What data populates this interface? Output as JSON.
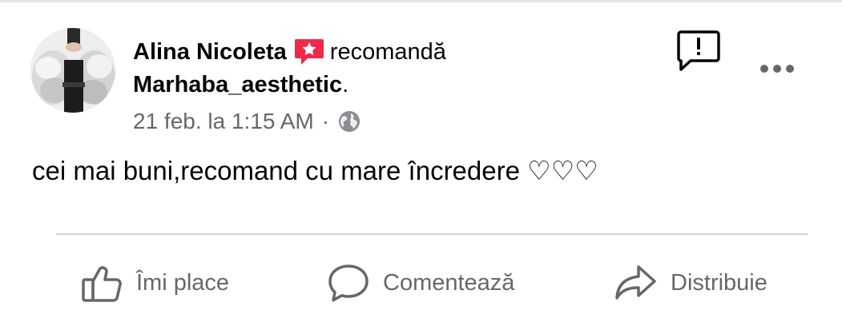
{
  "post": {
    "author_name": "Alina Nicoleta",
    "recommend_verb": "recomandă",
    "page_name": "Marhaba_aesthetic",
    "page_suffix": ".",
    "timestamp": "21 feb. la 1:15 AM",
    "separator": "·",
    "audience_icon": "globe-icon",
    "body_text": "cei mai buni,recomand cu mare încredere ♡♡♡"
  },
  "header_actions": {
    "report_icon": "report-icon",
    "more_icon": "more-options-icon"
  },
  "actions": {
    "like_label": "Îmi place",
    "comment_label": "Comentează",
    "share_label": "Distribuie"
  },
  "colors": {
    "primary_text": "#050505",
    "secondary_text": "#65676b",
    "recommend_badge": "#f02849",
    "divider": "#ced0d4"
  }
}
